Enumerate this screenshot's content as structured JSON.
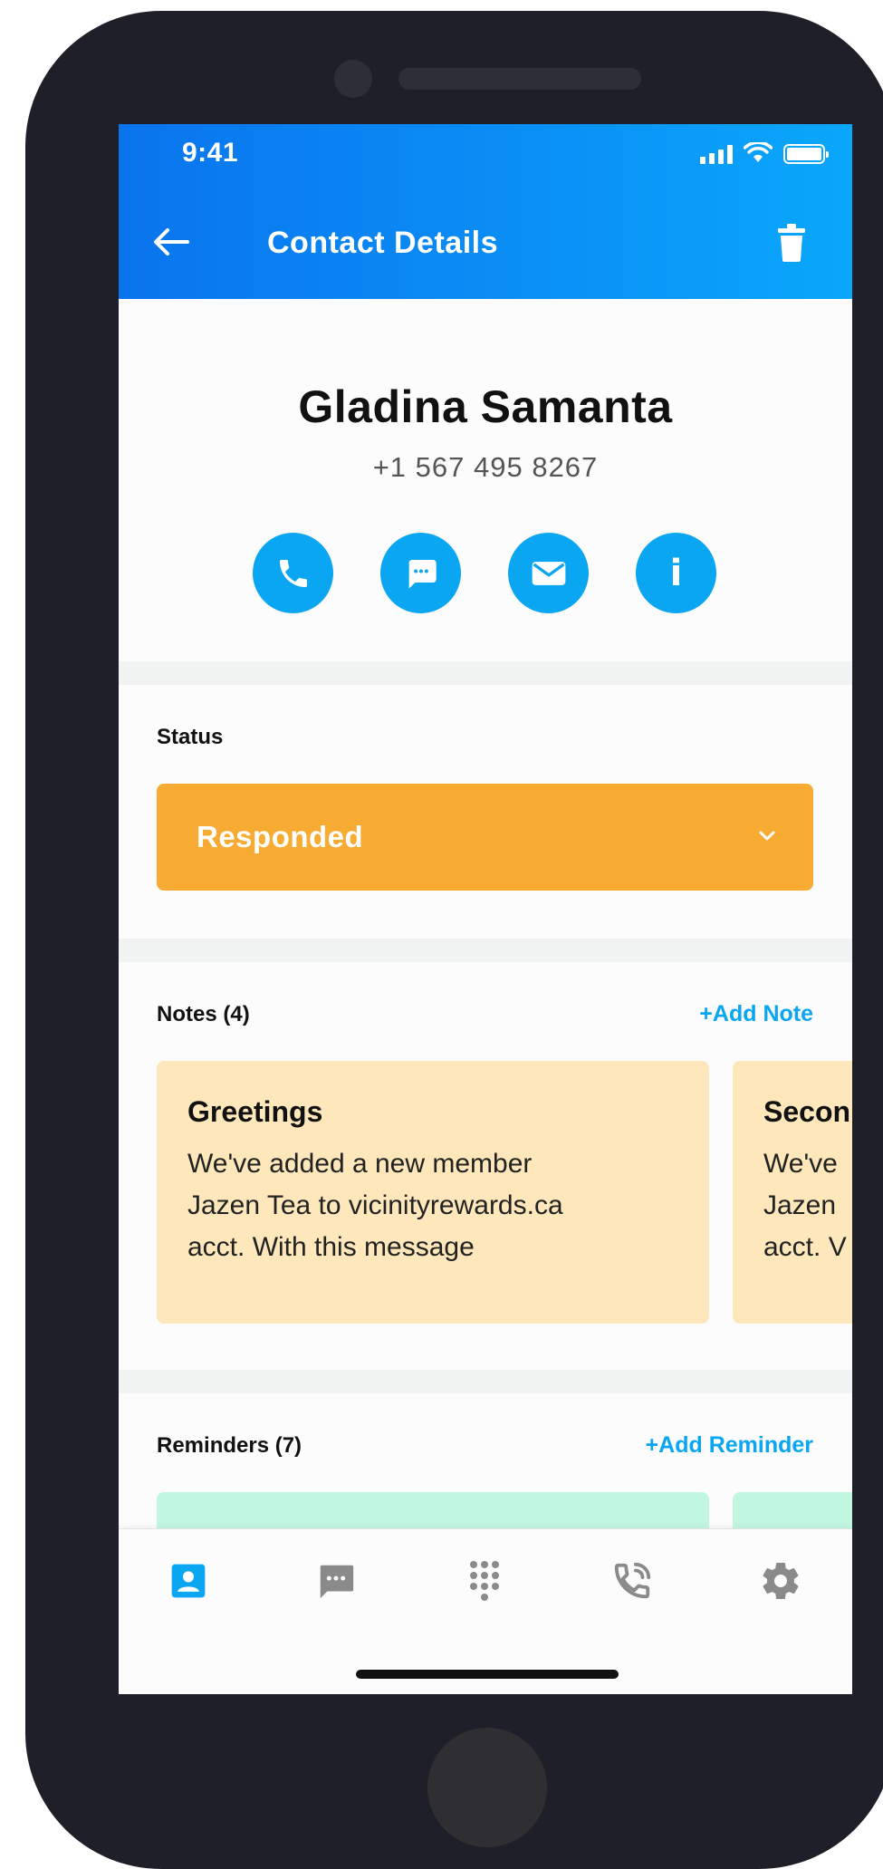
{
  "status_bar": {
    "time": "9:41"
  },
  "header": {
    "title": "Contact Details"
  },
  "contact": {
    "name": "Gladina Samanta",
    "phone": "+1 567 495 8267"
  },
  "actions": [
    {
      "icon": "phone-icon"
    },
    {
      "icon": "message-icon"
    },
    {
      "icon": "mail-icon"
    },
    {
      "icon": "info-icon",
      "glyph": "i"
    }
  ],
  "status": {
    "label": "Status",
    "value": "Responded",
    "color": "#f8ab33"
  },
  "notes": {
    "label": "Notes (4)",
    "add_label": "+Add Note",
    "items": [
      {
        "title": "Greetings",
        "body": "We've added a new member\nJazen Tea to vicinityrewards.ca\nacct. With this message"
      },
      {
        "title": "Secon",
        "body": "We've\nJazen\nacct. V"
      }
    ]
  },
  "reminders": {
    "label": "Reminders (7)",
    "add_label": "+Add Reminder"
  },
  "tabbar": {
    "active_color": "#0aa6f2",
    "inactive_color": "#8a8a8a",
    "tabs": [
      {
        "icon": "contacts-icon",
        "active": true
      },
      {
        "icon": "chat-icon",
        "active": false
      },
      {
        "icon": "dialpad-icon",
        "active": false
      },
      {
        "icon": "call-log-icon",
        "active": false
      },
      {
        "icon": "settings-icon",
        "active": false
      }
    ]
  },
  "theme": {
    "primary": "#0aa6f2",
    "header_start": "#0a74ee",
    "header_end": "#0aa7fb",
    "note_bg": "#fde7bb",
    "reminder_bg": "#c1f7e1"
  }
}
